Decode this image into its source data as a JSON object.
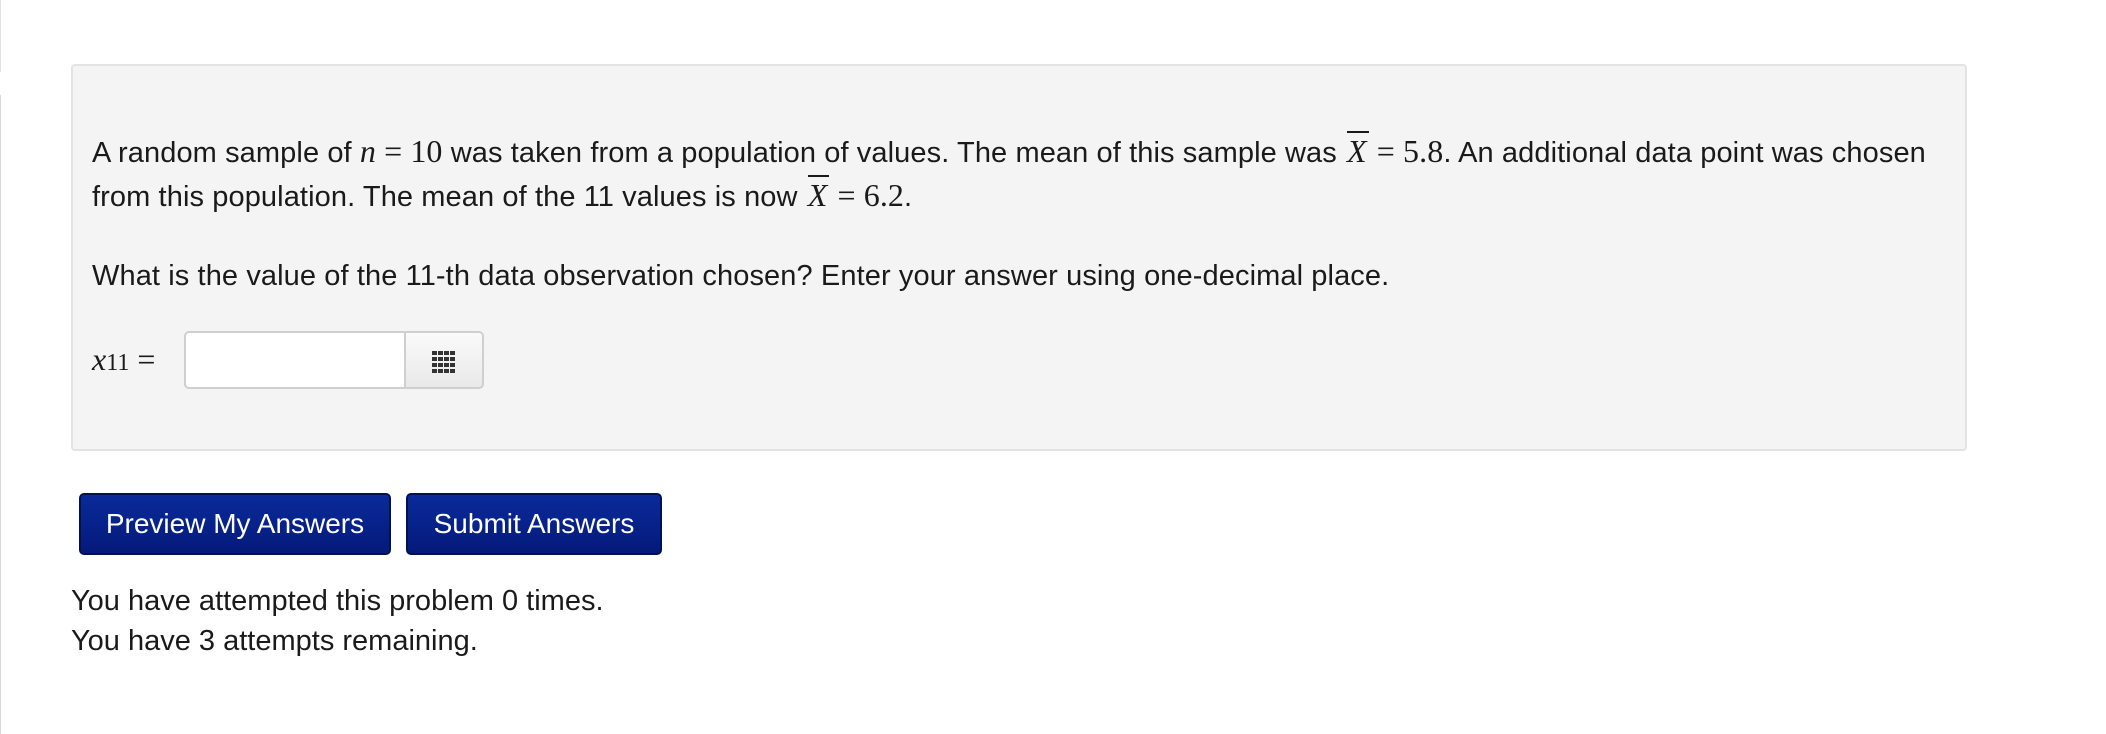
{
  "problem": {
    "line1": {
      "t1": "A random sample of ",
      "n_var": "n",
      "eq1": " = 10",
      "t2": " was taken from a population of values. The mean of this sample was ",
      "xbar1": "X",
      "eq2": " = 5.8",
      "t3": ". An additional data point was chosen"
    },
    "line2": {
      "t1": "from this population. The mean of the 11 values is now ",
      "xbar2": "X",
      "eq3": " = 6.2",
      "t2": "."
    },
    "question": "What is the value of the 11-th data observation chosen? Enter your answer using one-decimal place."
  },
  "answer": {
    "var": "x",
    "sub": "11",
    "eq": " =",
    "value": "",
    "placeholder": ""
  },
  "buttons": {
    "preview": "Preview My Answers",
    "submit": "Submit Answers"
  },
  "status": {
    "attempted": "You have attempted this problem 0 times.",
    "remaining": "You have 3 attempts remaining."
  },
  "colors": {
    "button_bg": "#06218a",
    "panel_bg": "#f4f4f4"
  },
  "icons": {
    "answer_tool": "grid-keypad-icon"
  }
}
